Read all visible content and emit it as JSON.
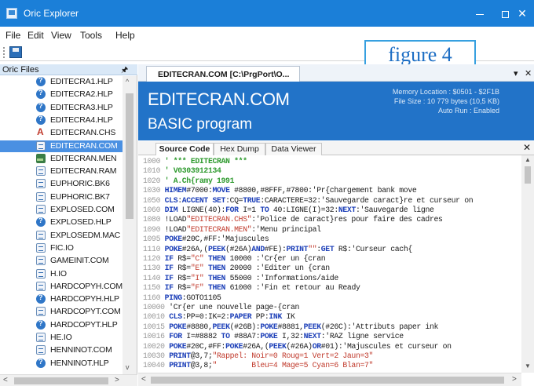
{
  "window": {
    "title": "Oric Explorer",
    "min_label": "",
    "max_label": "",
    "close_label": "✕"
  },
  "menu": [
    "File",
    "Edit",
    "View",
    "Tools",
    "Help"
  ],
  "figure_label": "figure 4",
  "files_panel": {
    "title": "Oric Files",
    "pin": "📌",
    "items": [
      {
        "name": "EDITECRA1.HLP",
        "icon": "help-icon"
      },
      {
        "name": "EDITECRA2.HLP",
        "icon": "help-icon"
      },
      {
        "name": "EDITECRA3.HLP",
        "icon": "help-icon"
      },
      {
        "name": "EDITECRA4.HLP",
        "icon": "help-icon"
      },
      {
        "name": "EDITECRAN.CHS",
        "icon": "charset-icon"
      },
      {
        "name": "EDITECRAN.COM",
        "icon": "document-icon",
        "selected": true
      },
      {
        "name": "EDITECRAN.MEN",
        "icon": "screen-icon"
      },
      {
        "name": "EDITECRAN.RAM",
        "icon": "document-icon"
      },
      {
        "name": "EUPHORIC.BK6",
        "icon": "document-icon"
      },
      {
        "name": "EUPHORIC.BK7",
        "icon": "document-icon"
      },
      {
        "name": "EXPLOSED.COM",
        "icon": "document-icon"
      },
      {
        "name": "EXPLOSED.HLP",
        "icon": "help-icon"
      },
      {
        "name": "EXPLOSEDM.MAC",
        "icon": "document-icon"
      },
      {
        "name": "FIC.IO",
        "icon": "document-icon"
      },
      {
        "name": "GAMEINIT.COM",
        "icon": "document-icon"
      },
      {
        "name": "H.IO",
        "icon": "document-icon"
      },
      {
        "name": "HARDCOPYH.COM",
        "icon": "document-icon"
      },
      {
        "name": "HARDCOPYH.HLP",
        "icon": "help-icon"
      },
      {
        "name": "HARDCOPYT.COM",
        "icon": "document-icon"
      },
      {
        "name": "HARDCOPYT.HLP",
        "icon": "help-icon"
      },
      {
        "name": "HE.IO",
        "icon": "document-icon"
      },
      {
        "name": "HENNINOT.COM",
        "icon": "document-icon"
      },
      {
        "name": "HENNINOT.HLP",
        "icon": "help-icon"
      }
    ]
  },
  "doc_tab": {
    "label": "EDITECRAN.COM [C:\\PrgPort\\O...",
    "dropdown": "▾",
    "close": "✕"
  },
  "banner": {
    "name": "EDITECRAN.COM",
    "type": "BASIC program",
    "memory": "Memory Location :  $0501 - $2F1B",
    "size": "File Size :  10 779 bytes (10,5 KB)",
    "autorun": "Auto Run :  Enabled"
  },
  "view_tabs": [
    "Source Code",
    "Hex Dump",
    "Data Viewer"
  ],
  "view_close": "✕",
  "code_lines": [
    {
      "n": "1000",
      "t": " ' *** EDITECRAN ***",
      "kind": "comment"
    },
    {
      "n": "1010",
      "t": " ' V0303912134",
      "kind": "comment"
    },
    {
      "n": "1020",
      "t": " ' A.Ch{ramy 1991",
      "kind": "comment"
    },
    {
      "n": "1030",
      "t": " HIMEM#7000:MOVE #8800,#8FFF,#7800:'Pr{chargement bank move",
      "kind": "code"
    },
    {
      "n": "1050",
      "t": " CLS:ACCENT SET:CQ=TRUE:CARACTERE=32:'Sauvegarde caract}re et curseur on",
      "kind": "code"
    },
    {
      "n": "1060",
      "t": " DIM LIGNE(40):FOR I=1 TO 40:LIGNE(I)=32:NEXT:'Sauvegarde ligne",
      "kind": "code"
    },
    {
      "n": "1080",
      "t": " !LOAD\"EDITECRAN.CHS\":'Police de caract}res pour faire des cadres",
      "kind": "code"
    },
    {
      "n": "1090",
      "t": " !LOAD\"EDITECRAN.MEN\":'Menu principal",
      "kind": "code"
    },
    {
      "n": "1095",
      "t": " POKE#20C,#FF:'Majuscules",
      "kind": "code"
    },
    {
      "n": "1110",
      "t": " POKE#26A,(PEEK(#26A)AND#FE):PRINT\"\":GET R$:'Curseur cach{",
      "kind": "code"
    },
    {
      "n": "1120",
      "t": " IF R$=\"C\" THEN 10000 :'Cr{er un {cran",
      "kind": "code"
    },
    {
      "n": "1130",
      "t": " IF R$=\"E\" THEN 20000 :'Editer un {cran",
      "kind": "code"
    },
    {
      "n": "1140",
      "t": " IF R$=\"I\" THEN 55000 :'Informations/aide",
      "kind": "code"
    },
    {
      "n": "1150",
      "t": " IF R$=\"F\" THEN 61000 :'Fin et retour au Ready",
      "kind": "code"
    },
    {
      "n": "1160",
      "t": " PING:GOTO1105",
      "kind": "code"
    },
    {
      "n": "10000",
      "t": " 'Cr{er une nouvelle page-{cran",
      "kind": "code"
    },
    {
      "n": "10010",
      "t": " CLS:PP=0:IK=2:PAPER PP:INK IK",
      "kind": "code"
    },
    {
      "n": "10015",
      "t": " POKE#8880,PEEK(#26B):POKE#8881,PEEK(#26C):'Attributs paper ink",
      "kind": "code"
    },
    {
      "n": "10016",
      "t": " FOR I=#8882 TO #88A7:POKE I,32:NEXT:'RAZ ligne service",
      "kind": "code"
    },
    {
      "n": "10020",
      "t": " POKE#20C,#FF:POKE#26A,(PEEK(#26A)OR#01):'Majuscules et curseur on",
      "kind": "code"
    },
    {
      "n": "10030",
      "t": " PRINT@3,7;\"Rappel: Noir=0 Roug=1 Vert=2 Jaun=3\"",
      "kind": "code"
    },
    {
      "n": "10040",
      "t": " PRINT@3,8;\"        Bleu=4 Mage=5 Cyan=6 Blan=7\"",
      "kind": "code"
    }
  ],
  "scroll_glyphs": {
    "up": "▲",
    "down": "▼",
    "left": "<",
    "right": ">",
    "file_up": "^",
    "file_down": "v"
  },
  "colors": {
    "titlebar": "#1b7fd8",
    "banner": "#2273c8",
    "selection": "#4a90e2",
    "comment": "#2e9a2e",
    "keyword": "#1c3fb8",
    "string": "#c0392b"
  }
}
